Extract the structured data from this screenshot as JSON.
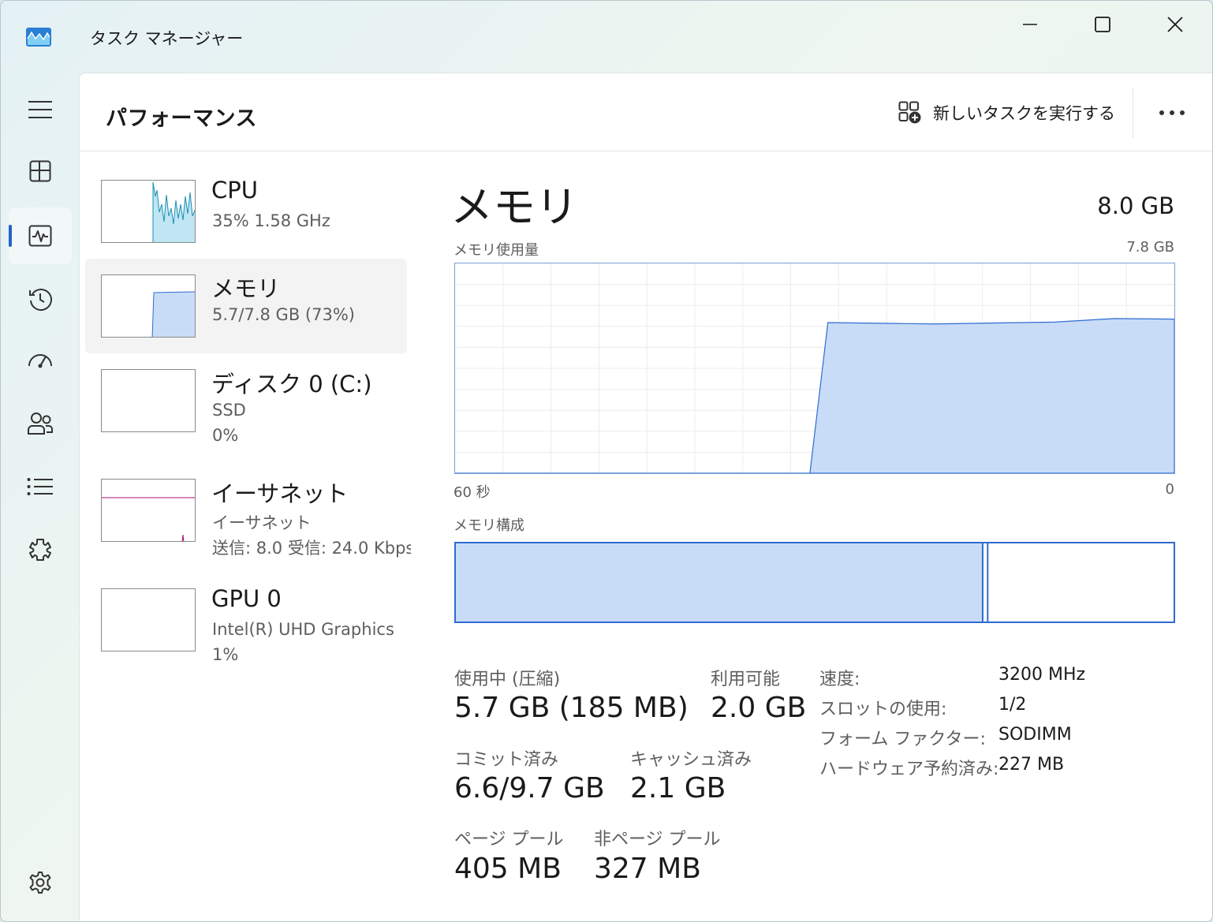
{
  "window": {
    "title": "タスク マネージャー"
  },
  "nav": {
    "items": [
      {
        "name": "hamburger-menu-icon"
      },
      {
        "name": "processes-icon"
      },
      {
        "name": "performance-icon"
      },
      {
        "name": "app-history-icon"
      },
      {
        "name": "startup-apps-icon"
      },
      {
        "name": "users-icon"
      },
      {
        "name": "details-icon"
      },
      {
        "name": "services-icon"
      },
      {
        "name": "settings-icon"
      }
    ],
    "active": "performance-icon"
  },
  "header": {
    "title": "パフォーマンス",
    "run_task_label": "新しいタスクを実行する"
  },
  "devices": [
    {
      "name": "CPU",
      "line1": "35%  1.58 GHz",
      "line2": ""
    },
    {
      "name": "メモリ",
      "line1": "5.7/7.8 GB (73%)",
      "line2": ""
    },
    {
      "name": "ディスク 0 (C:)",
      "line1": "SSD",
      "line2": "0%"
    },
    {
      "name": "イーサネット",
      "line1": "イーサネット",
      "line2": "送信: 8.0  受信: 24.0 Kbps"
    },
    {
      "name": "GPU 0",
      "line1": "Intel(R) UHD Graphics",
      "line2": "1%"
    }
  ],
  "detail": {
    "title": "メモリ",
    "total": "8.0 GB",
    "usage_label": "メモリ使用量",
    "usage_max": "7.8 GB",
    "axis_left": "60 秒",
    "axis_right": "0",
    "composition_label": "メモリ構成",
    "stats": {
      "in_use_label": "使用中 (圧縮)",
      "in_use_value": "5.7 GB (185 MB)",
      "available_label": "利用可能",
      "available_value": "2.0 GB",
      "committed_label": "コミット済み",
      "committed_value": "6.6/9.7 GB",
      "cached_label": "キャッシュ済み",
      "cached_value": "2.1 GB",
      "paged_label": "ページ プール",
      "paged_value": "405 MB",
      "nonpaged_label": "非ページ プール",
      "nonpaged_value": "327 MB"
    },
    "specs": [
      {
        "key": "速度:",
        "value": "3200 MHz"
      },
      {
        "key": "スロットの使用:",
        "value": "1/2"
      },
      {
        "key": "フォーム ファクター:",
        "value": "SODIMM"
      },
      {
        "key": "ハードウェア予約済み:",
        "value": "227 MB"
      }
    ],
    "composition": {
      "in_use_fraction": 0.734,
      "modified_fraction": 0.007
    }
  },
  "chart_data": {
    "type": "area",
    "title": "メモリ使用量",
    "xlabel": "",
    "ylabel": "",
    "xlim": [
      60,
      0
    ],
    "ylim": [
      0,
      7.8
    ],
    "x": [
      60,
      30.4,
      28.9,
      20,
      10,
      5,
      0
    ],
    "values": [
      0,
      0,
      5.6,
      5.55,
      5.62,
      5.75,
      5.73
    ],
    "grid": true
  },
  "colors": {
    "accent": "#2463c9",
    "memory_fill": "#c9dcf7",
    "memory_line": "#2f6bd2",
    "cpu_fill": "#bfe6f2",
    "cpu_line": "#1a8fb5",
    "disk_line": "#4f9a1a",
    "net_line": "#a3107c",
    "gpu_line": "#7f2fc9"
  }
}
